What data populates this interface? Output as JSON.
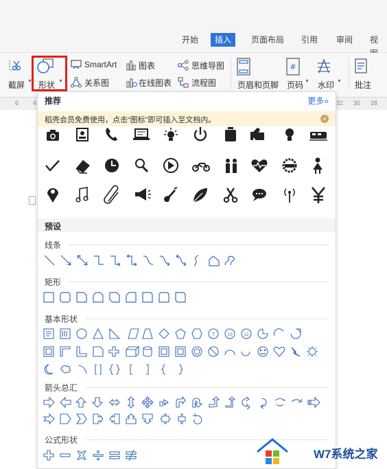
{
  "tabs": [
    "开始",
    "插入",
    "页面布局",
    "引用",
    "审阅",
    "视图"
  ],
  "active_tab": "插入",
  "ribbon": {
    "screenshot_label": "截屏",
    "shape_label": "形状",
    "smartart_label": "SmartArt",
    "chart_label": "图表",
    "mindmap_label": "思维导图",
    "relation_label": "关系图",
    "online_chart_label": "在线图表",
    "flowchart_label": "流程图",
    "header_footer_label": "页眉和页脚",
    "page_number_label": "页码",
    "watermark_label": "水印",
    "comment_label": "批注"
  },
  "ruler": [
    "6",
    "4",
    "32",
    "28",
    "30"
  ],
  "panel": {
    "recommend_title": "推荐",
    "more_label": "更多",
    "notice_text": "稻壳会员免费使用，点击“图标”即可插入至文档内。",
    "preset_title": "预设",
    "sections": {
      "lines": "线条",
      "rect": "矩形",
      "basic": "基本形状",
      "arrows": "箭头总汇",
      "formula": "公式形状"
    },
    "icons_row1": [
      "camera-icon",
      "id-card-icon",
      "phone-icon",
      "laptop-icon",
      "bulb-idea-icon",
      "power-icon",
      "bottle-icon",
      "thumb-icon",
      "lightbulb-icon",
      "train-icon"
    ],
    "icons_row2": [
      "check-icon",
      "eraser-icon",
      "clock-icon",
      "magnifier-icon",
      "play-icon",
      "motorbike-icon",
      "family-icon",
      "heart-pulse-icon",
      "wreath-icon",
      "girl-icon"
    ],
    "icons_row3": [
      "location-pin-icon",
      "music-note-icon",
      "paperclip-icon",
      "megaphone-icon",
      "guitar-icon",
      "leaf-icon",
      "scissors-icon",
      "chat-bubble-icon",
      "signal-icon",
      "yen-icon"
    ]
  },
  "watermark": {
    "brand": "W7系统之家",
    "url": "www.w7xitong.com"
  },
  "colors": {
    "accent": "#2d74d8",
    "highlight_box": "#e0201b",
    "notice_bg": "#fdf3d8",
    "shape_stroke": "#3a6fb7"
  }
}
